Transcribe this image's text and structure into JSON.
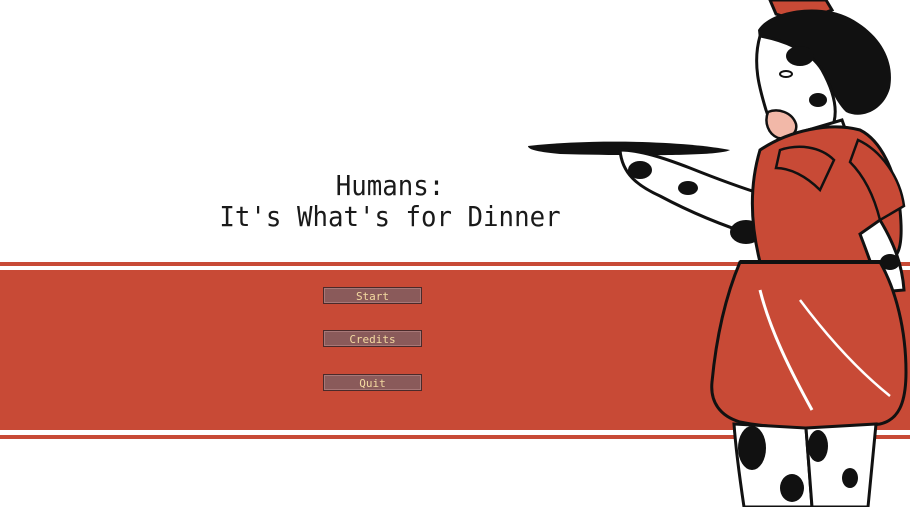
{
  "title": {
    "line1": "Humans:",
    "line2": "It's What's for Dinner"
  },
  "menu": {
    "start_label": "Start",
    "credits_label": "Credits",
    "quit_label": "Quit"
  },
  "colors": {
    "band_red": "#c84a36",
    "button_fill": "#8a5a5a",
    "button_text": "#f3d9a0",
    "title_text": "#1a1a1a"
  },
  "art": {
    "character": "cow-waitress-illustration"
  }
}
